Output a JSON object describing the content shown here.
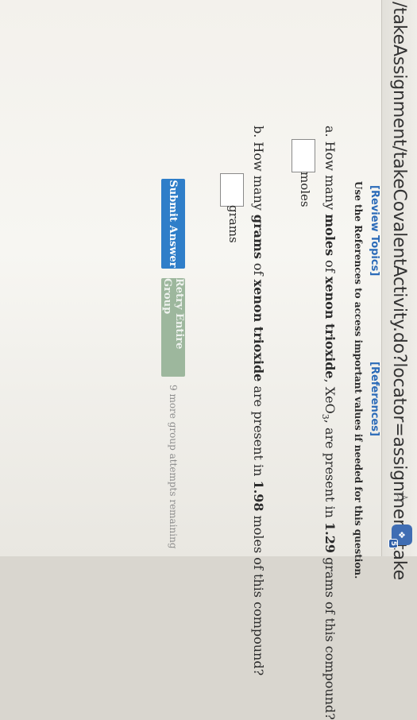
{
  "browser": {
    "url": "/takeAssignment/takeCovalentActivity.do?locator=assignment-take",
    "bookmark_icon": "star-icon",
    "extension_badge": "5"
  },
  "links": {
    "review_topics": "[Review Topics]",
    "references": "[References]"
  },
  "instruction": "Use the References to access important values if needed for this question.",
  "question_a": {
    "prefix": "a. How many ",
    "bold1": "moles",
    "mid1": " of ",
    "bold2": "xenon trioxide",
    "mid2": ", XeO",
    "subscript": "3",
    "mid3": ", are present in ",
    "bold3": "1.29",
    "suffix": " grams of this compound?",
    "unit": "moles",
    "answer_value": ""
  },
  "question_b": {
    "prefix": "b. How many ",
    "bold1": "grams",
    "mid1": " of ",
    "bold2": "xenon trioxide",
    "mid2": " are present in ",
    "bold3": "1.98",
    "suffix": " moles of this compound?",
    "unit": "grams",
    "answer_value": ""
  },
  "buttons": {
    "submit": "Submit Answer",
    "retry": "Retry Entire Group"
  },
  "attempts_text": "9 more group attempts remaining",
  "colors": {
    "link": "#2a6ab8",
    "submit": "#2f7ec9",
    "retry": "#9db79d"
  }
}
